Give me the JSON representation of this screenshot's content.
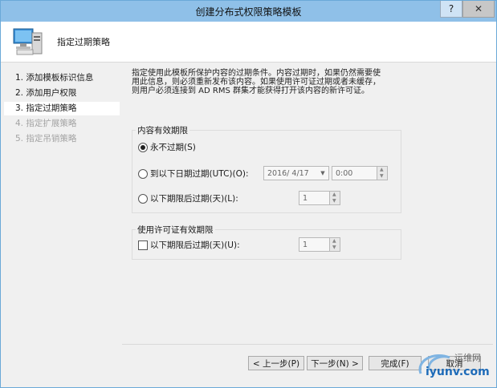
{
  "window": {
    "title": "创建分布式权限策略模板",
    "help": "?",
    "close": "✕"
  },
  "header": {
    "title": "指定过期策略"
  },
  "sidebar": {
    "steps": [
      {
        "label": "1.  添加模板标识信息",
        "state": "normal"
      },
      {
        "label": "2.  添加用户权限",
        "state": "normal"
      },
      {
        "label": "3.  指定过期策略",
        "state": "active"
      },
      {
        "label": "4.  指定扩展策略",
        "state": "disabled"
      },
      {
        "label": "5.  指定吊销策略",
        "state": "disabled"
      }
    ]
  },
  "main": {
    "description": "指定使用此模板所保护内容的过期条件。内容过期时，如果仍然需要使用此信息，则必须重新发布该内容。如果使用许可证过期或者未缓存，则用户必须连接到 AD RMS 群集才能获得打开该内容的新许可证。",
    "content_group": {
      "title": "内容有效期限",
      "never": "永不过期(S)",
      "on_date": "到以下日期过期(UTC)(O):",
      "date_value": "2016/ 4/17",
      "time_value": "0:00",
      "after_days": "以下期限后过期(天)(L):",
      "days_value": "1",
      "selected": "never"
    },
    "license_group": {
      "title": "使用许可证有效期限",
      "after_days": "以下期限后过期(天)(U):",
      "days_value": "1",
      "checked": false
    }
  },
  "footer": {
    "back": "< 上一步(P)",
    "next": "下一步(N) >",
    "finish": "完成(F)",
    "cancel": "取消"
  },
  "watermark": {
    "brand": "iyunv.com",
    "cn": "运维网"
  }
}
